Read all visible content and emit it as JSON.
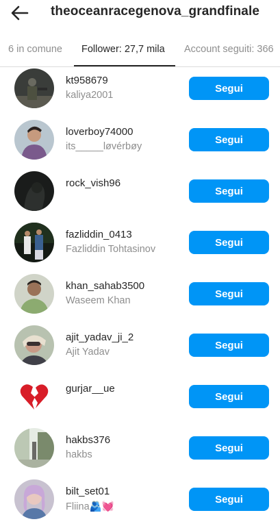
{
  "header": {
    "title": "theoceanracegenova_grandfinale"
  },
  "tabs": [
    {
      "label": "6 in comune"
    },
    {
      "label": "Follower: 27,7 mila"
    },
    {
      "label": "Account seguiti: 366"
    }
  ],
  "active_tab": "Follower: 27,7 mila",
  "colors": {
    "accent": "#0095f6",
    "primary_text": "#262626",
    "secondary_text": "#8e8e8e"
  },
  "follow_label": "Segui",
  "users": [
    {
      "username": "kt958679",
      "fullname": "kaliya2001"
    },
    {
      "username": "loverboy74000",
      "fullname": "its_____løvérbøy"
    },
    {
      "username": "rock_vish96",
      "fullname": ""
    },
    {
      "username": "fazliddin_0413",
      "fullname": "Fazliddin Tohtasinov"
    },
    {
      "username": "khan_sahab3500",
      "fullname": "Waseem Khan"
    },
    {
      "username": "ajit_yadav_ji_2",
      "fullname": "Ajit Yadav"
    },
    {
      "username": "gurjar__ue",
      "fullname": ""
    },
    {
      "username": "hakbs376",
      "fullname": "hakbs"
    },
    {
      "username": "bilt_set01",
      "fullname": "Fliina🫂💓"
    }
  ]
}
